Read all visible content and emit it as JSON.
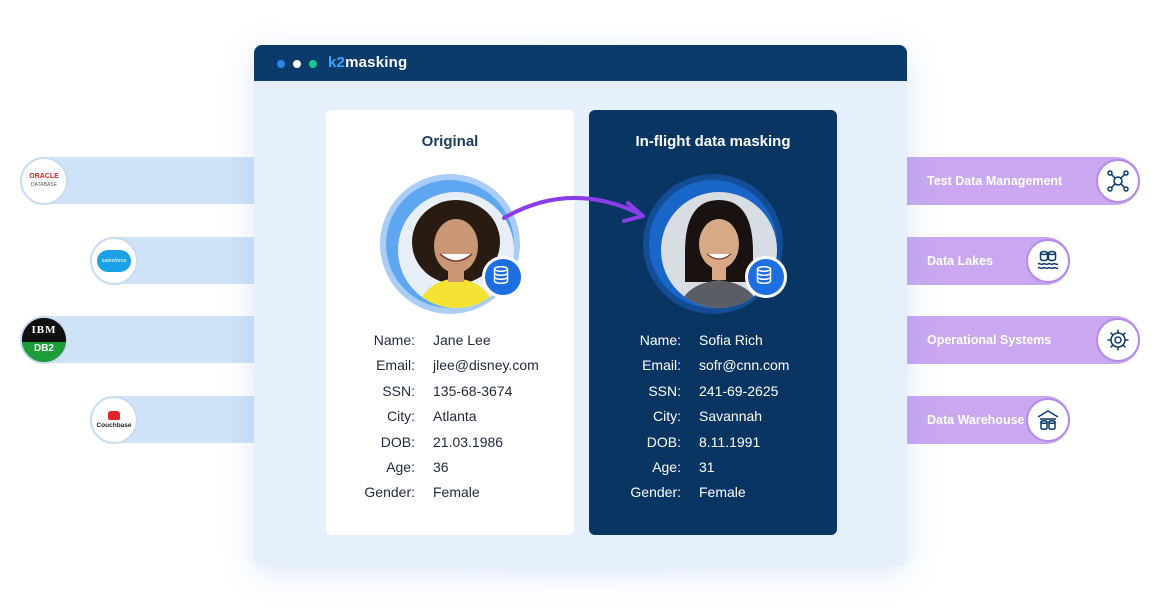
{
  "app": {
    "brand_prefix": "k2",
    "brand_name": "masking"
  },
  "original": {
    "title": "Original",
    "fields": [
      {
        "label": "Name:",
        "value": "Jane Lee"
      },
      {
        "label": "Email:",
        "value": "jlee@disney.com"
      },
      {
        "label": "SSN:",
        "value": "135-68-3674"
      },
      {
        "label": "City:",
        "value": "Atlanta"
      },
      {
        "label": "DOB:",
        "value": "21.03.1986"
      },
      {
        "label": "Age:",
        "value": "36"
      },
      {
        "label": "Gender:",
        "value": "Female"
      }
    ]
  },
  "masked": {
    "title": "In-flight data masking",
    "fields": [
      {
        "label": "Name:",
        "value": "Sofia Rich"
      },
      {
        "label": "Email:",
        "value": "sofr@cnn.com"
      },
      {
        "label": "SSN:",
        "value": "241-69-2625"
      },
      {
        "label": "City:",
        "value": "Savannah"
      },
      {
        "label": "DOB:",
        "value": "8.11.1991"
      },
      {
        "label": "Age:",
        "value": "31"
      },
      {
        "label": "Gender:",
        "value": "Female"
      }
    ]
  },
  "sources": [
    {
      "name": "oracle",
      "logo_line1": "ORACLE",
      "logo_line2": "DATABASE"
    },
    {
      "name": "salesforce",
      "logo_line1": "salesforce"
    },
    {
      "name": "ibm-db2",
      "logo_line1": "IBM",
      "logo_line2": "DB2"
    },
    {
      "name": "couchbase",
      "logo_line1": "Couchbase"
    }
  ],
  "targets": [
    {
      "label": "Test Data Management",
      "icon": "network-icon"
    },
    {
      "label": "Data Lakes",
      "icon": "data-lake-icon"
    },
    {
      "label": "Operational Systems",
      "icon": "gear-icon"
    },
    {
      "label": "Data Warehouse",
      "icon": "warehouse-icon"
    }
  ],
  "colors": {
    "title_bar": "#0b3b6a",
    "masked_card": "#093563",
    "source_band": "#cfe3f8",
    "target_band": "#c9a8ef",
    "arrow": "#2b7fe0",
    "curve_arrow": "#8a3ee8"
  }
}
